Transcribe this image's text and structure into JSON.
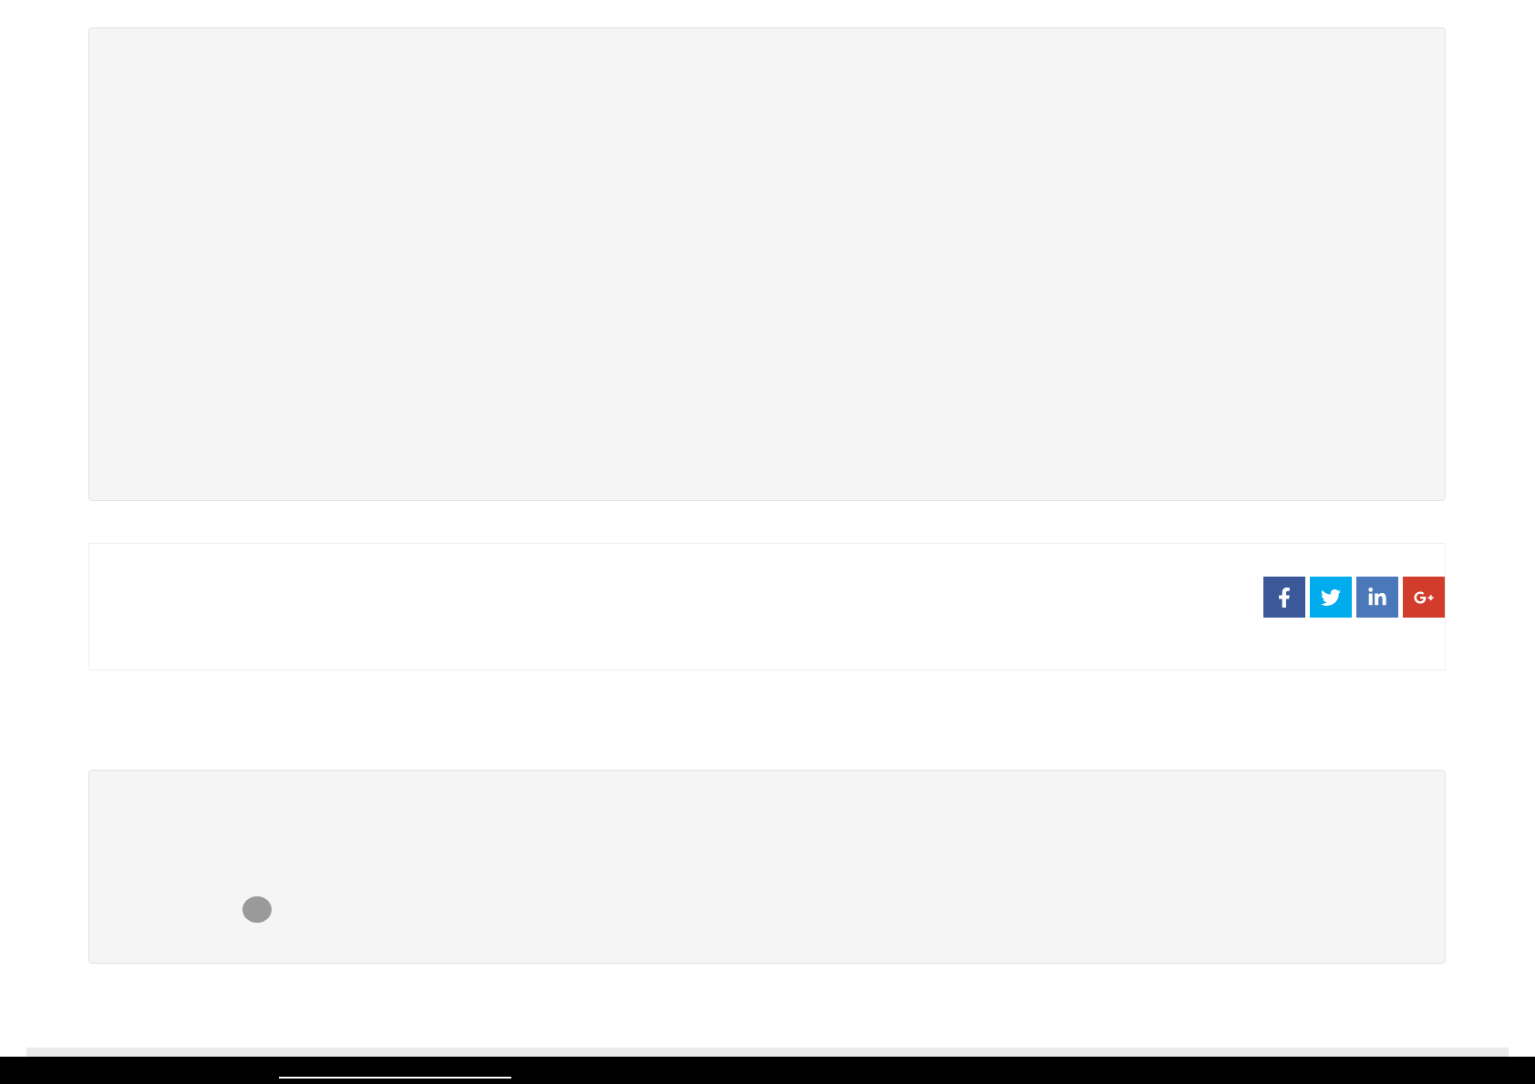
{
  "share_buttons": [
    {
      "kind": "facebook",
      "color": "#3b5998"
    },
    {
      "kind": "twitter",
      "color": "#00aced"
    },
    {
      "kind": "linkedin",
      "color": "#4a78b8"
    },
    {
      "kind": "googleplus",
      "color": "#d23c2a"
    }
  ]
}
